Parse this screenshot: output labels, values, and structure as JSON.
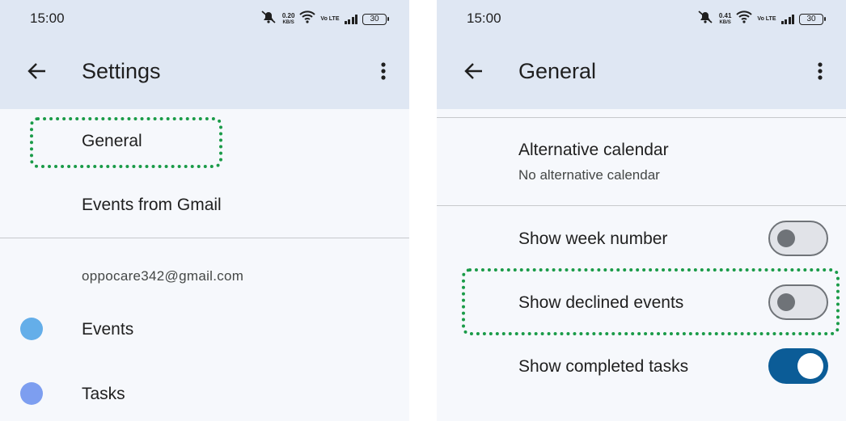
{
  "colors": {
    "header_bg": "#dfe7f3",
    "page_bg": "#f6f8fc",
    "highlight": "#1a9b48",
    "toggle_on": "#0b5c97",
    "events_dot": "#64aee9",
    "tasks_dot": "#7d9ef0"
  },
  "left": {
    "status": {
      "time": "15:00",
      "net_speed": "0.20",
      "net_unit": "KB/S",
      "volte": "Vo LTE",
      "battery": "30"
    },
    "appbar": {
      "title": "Settings",
      "back_icon": "arrow-back-icon",
      "more_icon": "more-vert-icon"
    },
    "items": {
      "general": "General",
      "events_from_gmail": "Events from Gmail"
    },
    "account": {
      "email": "oppocare342@gmail.com",
      "calendars": [
        {
          "label": "Events",
          "color": "#64aee9"
        },
        {
          "label": "Tasks",
          "color": "#7d9ef0"
        }
      ]
    }
  },
  "right": {
    "status": {
      "time": "15:00",
      "net_speed": "0.41",
      "net_unit": "KB/S",
      "volte": "Vo LTE",
      "battery": "30"
    },
    "appbar": {
      "title": "General",
      "back_icon": "arrow-back-icon",
      "more_icon": "more-vert-icon"
    },
    "alt_calendar": {
      "label": "Alternative calendar",
      "value": "No alternative calendar"
    },
    "toggles": [
      {
        "label": "Show week number",
        "on": false
      },
      {
        "label": "Show declined events",
        "on": false
      },
      {
        "label": "Show completed tasks",
        "on": true
      }
    ]
  }
}
